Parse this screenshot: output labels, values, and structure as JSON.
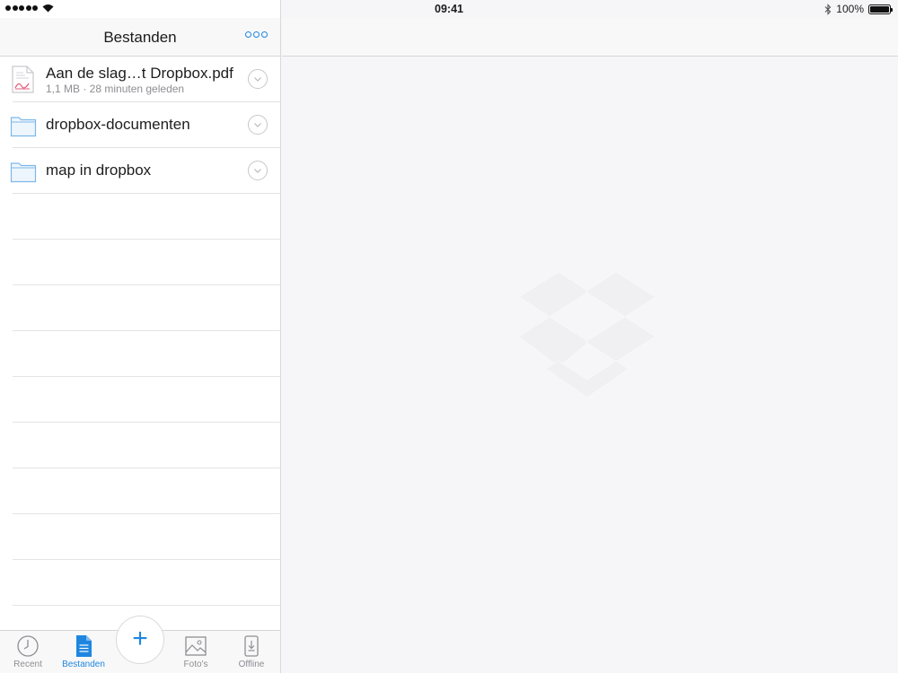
{
  "status_bar": {
    "time": "09:41",
    "battery": "100%"
  },
  "left_pane": {
    "title": "Bestanden",
    "more_icon": "more-icon"
  },
  "files": [
    {
      "name": "Aan de slag…t Dropbox.pdf",
      "meta": "1,1 MB · 28 minuten geleden",
      "type": "pdf"
    },
    {
      "name": "dropbox-documenten",
      "type": "folder"
    },
    {
      "name": "map in dropbox",
      "type": "folder"
    }
  ],
  "tabs": [
    {
      "label": "Recent",
      "icon": "clock-icon",
      "active": false
    },
    {
      "label": "Bestanden",
      "icon": "document-icon",
      "active": true
    },
    {
      "label": "Foto's",
      "icon": "photo-icon",
      "active": false
    },
    {
      "label": "Offline",
      "icon": "offline-icon",
      "active": false
    }
  ],
  "fab_icon": "plus-icon",
  "colors": {
    "accent": "#1f86e0",
    "background": "#f6f6f8",
    "separator": "#e1e1e4"
  }
}
